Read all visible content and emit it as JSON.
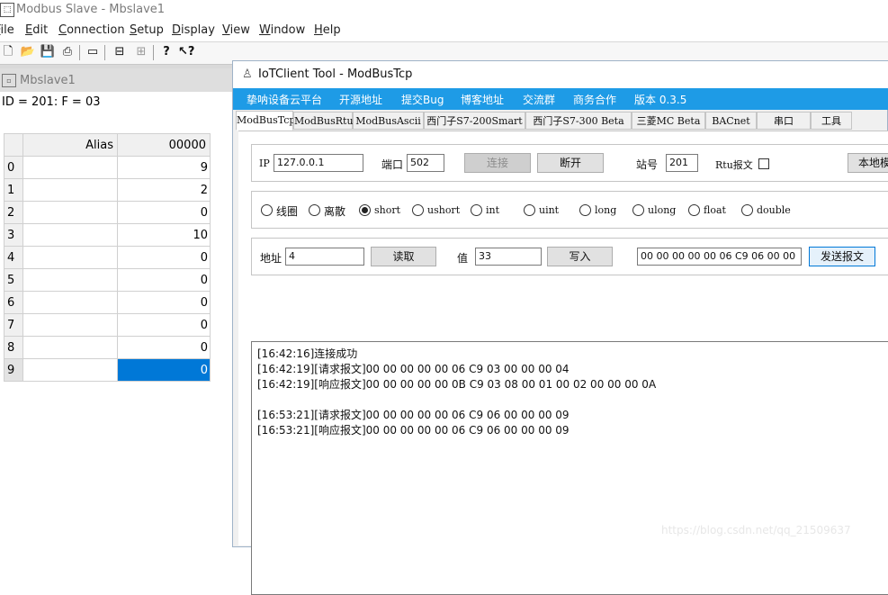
{
  "modbus_slave": {
    "title": "Modbus Slave - Mbslave1",
    "menu": [
      "File",
      "Edit",
      "Connection",
      "Setup",
      "Display",
      "View",
      "Window",
      "Help"
    ],
    "toolbar_icons": [
      "new-file-icon",
      "open-folder-icon",
      "save-icon",
      "print-icon",
      "window-icon",
      "connect-icon",
      "disconnect-icon",
      "help-icon",
      "context-help-icon"
    ],
    "child": {
      "title": "Mbslave1",
      "info": "ID = 201: F = 03",
      "columns": [
        "Alias",
        "00000"
      ],
      "rows": [
        {
          "index": "0",
          "alias": "",
          "value": "9"
        },
        {
          "index": "1",
          "alias": "",
          "value": "2"
        },
        {
          "index": "2",
          "alias": "",
          "value": "0"
        },
        {
          "index": "3",
          "alias": "",
          "value": "10"
        },
        {
          "index": "4",
          "alias": "",
          "value": "0"
        },
        {
          "index": "5",
          "alias": "",
          "value": "0"
        },
        {
          "index": "6",
          "alias": "",
          "value": "0"
        },
        {
          "index": "7",
          "alias": "",
          "value": "0"
        },
        {
          "index": "8",
          "alias": "",
          "value": "0"
        },
        {
          "index": "9",
          "alias": "",
          "value": "0"
        }
      ],
      "selected_row": "9"
    }
  },
  "iot_client": {
    "title": "IoTClient Tool - ModBusTcp",
    "nav": [
      "挚呐设备云平台",
      "开源地址",
      "提交Bug",
      "博客地址",
      "交流群",
      "商务合作",
      "版本 0.3.5"
    ],
    "tabs": [
      "ModBusTcp",
      "ModBusRtu",
      "ModBusAscii",
      "西门子S7-200Smart",
      "西门子S7-300 Beta",
      "三菱MC Beta",
      "BACnet",
      "串口",
      "工具"
    ],
    "active_tab": "ModBusTcp",
    "connection": {
      "ip_label": "IP",
      "ip_value": "127.0.0.1",
      "port_label": "端口",
      "port_value": "502",
      "connect_label": "连接",
      "disconnect_label": "断开",
      "station_label": "站号",
      "station_value": "201",
      "rtu_label": "Rtu报文",
      "local_label": "本地模"
    },
    "data_types": [
      {
        "label": "线圈",
        "checked": false
      },
      {
        "label": "离散",
        "checked": false
      },
      {
        "label": "short",
        "checked": true
      },
      {
        "label": "ushort",
        "checked": false
      },
      {
        "label": "int",
        "checked": false
      },
      {
        "label": "uint",
        "checked": false
      },
      {
        "label": "long",
        "checked": false
      },
      {
        "label": "ulong",
        "checked": false
      },
      {
        "label": "float",
        "checked": false
      },
      {
        "label": "double",
        "checked": false
      }
    ],
    "rw": {
      "address_label": "地址",
      "address_value": "4",
      "read_label": "读取",
      "value_label": "值",
      "value_value": "33",
      "write_label": "写入",
      "raw_message": "00 00 00 00 00 06 C9 06 00 00",
      "send_label": "发送报文"
    },
    "log": [
      "[16:42:16]连接成功",
      "[16:42:19][请求报文]00 00 00 00 00 06 C9 03 00 00 00 04",
      "[16:42:19][响应报文]00 00 00 00 00 0B C9 03 08 00 01 00 02 00 00 00 0A",
      "",
      "[16:53:21][请求报文]00 00 00 00 00 06 C9 06 00 00 00 09",
      "[16:53:21][响应报文]00 00 00 00 00 06 C9 06 00 00 00 09"
    ]
  },
  "watermark": "https://blog.csdn.net/qq_21509637"
}
